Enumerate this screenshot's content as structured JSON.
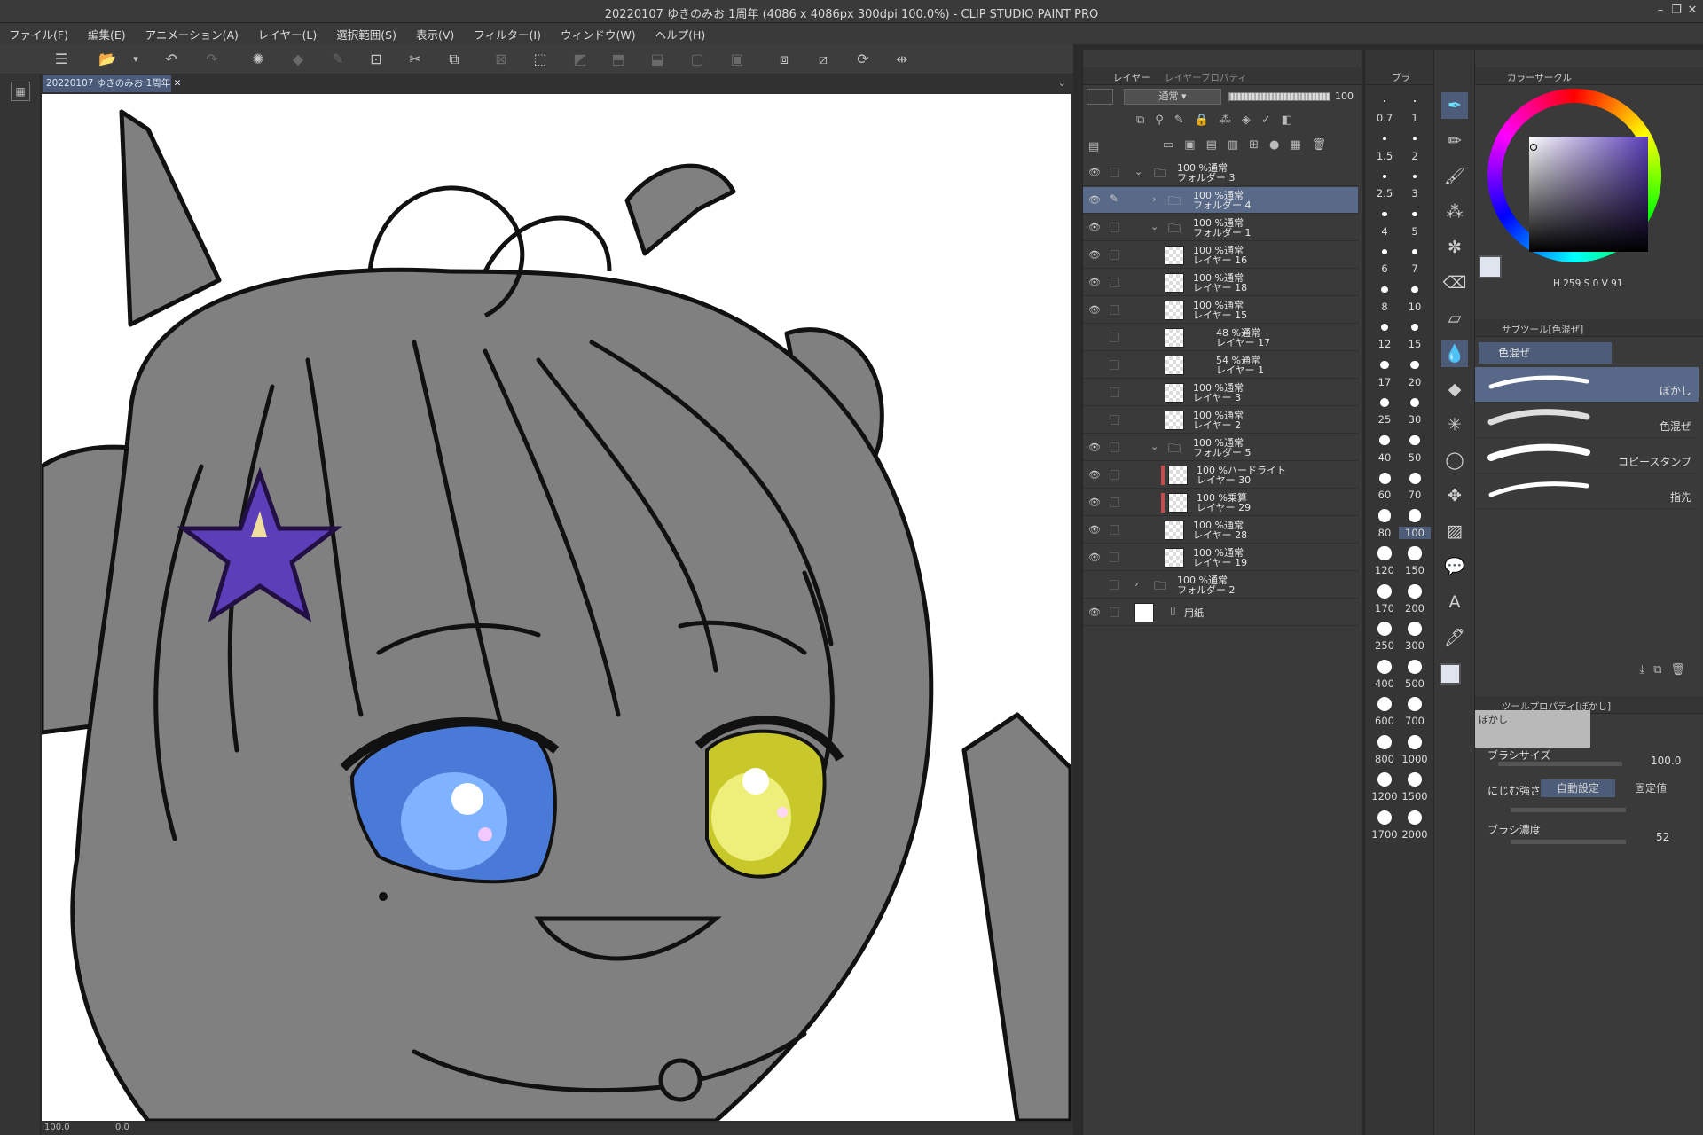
{
  "window": {
    "title": "20220107 ゆきのみお 1周年 (4086 x 4086px 300dpi 100.0%) - CLIP STUDIO PAINT PRO"
  },
  "menu": [
    "ファイル(F)",
    "編集(E)",
    "アニメーション(A)",
    "レイヤー(L)",
    "選択範囲(S)",
    "表示(V)",
    "フィルター(I)",
    "ウィンドウ(W)",
    "ヘルプ(H)"
  ],
  "document": {
    "tab": "20220107 ゆきのみお 1周年"
  },
  "status": {
    "zoom": "100.0",
    "angle": "0.0"
  },
  "layers": {
    "tab_layer": "レイヤー",
    "tab_property": "レイヤープロパティ",
    "blend_mode": "通常",
    "opacity": "100",
    "rows": [
      {
        "l1": "100 %通常",
        "l2": "フォルダー 3"
      },
      {
        "l1": "100 %通常",
        "l2": "フォルダー 4"
      },
      {
        "l1": "100 %通常",
        "l2": "フォルダー 1"
      },
      {
        "l1": "100 %通常",
        "l2": "レイヤー 16"
      },
      {
        "l1": "100 %通常",
        "l2": "レイヤー 18"
      },
      {
        "l1": "100 %通常",
        "l2": "レイヤー 15"
      },
      {
        "l1": "48 %通常",
        "l2": "レイヤー 17"
      },
      {
        "l1": "54 %通常",
        "l2": "レイヤー 1"
      },
      {
        "l1": "100 %通常",
        "l2": "レイヤー 3"
      },
      {
        "l1": "100 %通常",
        "l2": "レイヤー 2"
      },
      {
        "l1": "100 %通常",
        "l2": "フォルダー 5"
      },
      {
        "l1": "100 %ハードライト",
        "l2": "レイヤー 30"
      },
      {
        "l1": "100 %乗算",
        "l2": "レイヤー 29"
      },
      {
        "l1": "100 %通常",
        "l2": "レイヤー 28"
      },
      {
        "l1": "100 %通常",
        "l2": "レイヤー 19"
      },
      {
        "l1": "100 %通常",
        "l2": "フォルダー 2"
      },
      {
        "l1": "用紙",
        "l2": ""
      }
    ]
  },
  "brush_sizes": [
    "0.7",
    "1",
    "1.5",
    "2",
    "2.5",
    "3",
    "4",
    "5",
    "6",
    "7",
    "8",
    "10",
    "12",
    "15",
    "17",
    "20",
    "25",
    "30",
    "40",
    "50",
    "60",
    "70",
    "80",
    "100",
    "120",
    "150",
    "170",
    "200",
    "250",
    "300",
    "400",
    "500",
    "600",
    "700",
    "800",
    "1000",
    "1200",
    "1500",
    "1700",
    "2000"
  ],
  "color": {
    "tab": "カラーサークル",
    "h": "259",
    "s": "0",
    "v": "91",
    "accent": "#5b3fb8"
  },
  "subtool": {
    "tab": "サブツール[色混ぜ]",
    "group": "色混ぜ",
    "brushes": [
      "ぼかし",
      "色混ぜ",
      "コピースタンプ",
      "指先"
    ]
  },
  "toolprop": {
    "tab": "ツールプロパティ[ぼかし]",
    "name": "ぼかし",
    "brush_size_label": "ブラシサイズ",
    "brush_size": "100.0",
    "blend_label": "にじむ強さ",
    "blend_auto": "自動設定",
    "blend_fixed": "固定値",
    "density_label": "ブラシ濃度",
    "density": "52"
  },
  "panel_tab_short": "ブラ"
}
